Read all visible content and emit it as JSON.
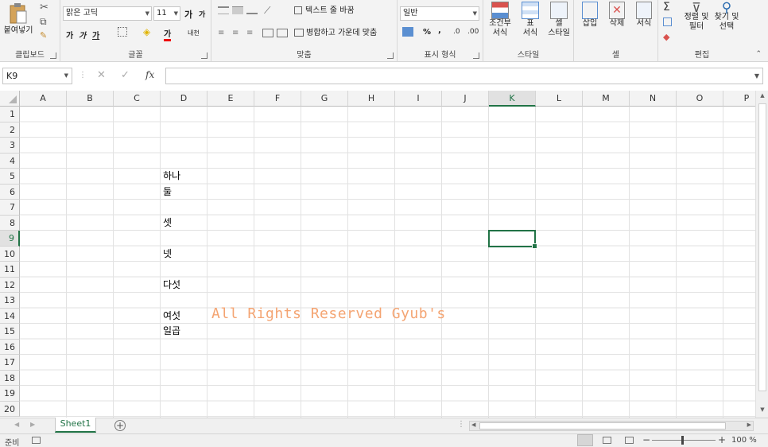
{
  "ribbon": {
    "clipboard": {
      "paste_label": "붙여넣기",
      "group_label": "클립보드"
    },
    "font": {
      "font_name": "맑은 고딕",
      "font_size": "11",
      "grow_label": "가",
      "shrink_label": "가",
      "bold_label": "가",
      "italic_label": "가",
      "underline_label": "가",
      "color_a_label": "가",
      "phonetic_label": "내천",
      "group_label": "글꼴"
    },
    "alignment": {
      "wrap_label": "텍스트 줄 바꿈",
      "merge_label": "병합하고 가운데 맞춤",
      "group_label": "맞춤"
    },
    "number": {
      "format_value": "일반",
      "percent_label": "%",
      "comma_label": ",",
      "group_label": "표시 형식"
    },
    "styles": {
      "conditional_label": "조건부",
      "conditional_sub": "서식",
      "table_label": "표",
      "table_sub": "서식",
      "cell_label": "셀",
      "cell_sub": "스타일",
      "group_label": "스타일"
    },
    "cells": {
      "insert_label": "삽입",
      "delete_label": "삭제",
      "format_label": "서식",
      "group_label": "셀"
    },
    "editing": {
      "sort_label": "정렬 및",
      "sort_sub": "필터",
      "find_label": "찾기 및",
      "find_sub": "선택",
      "group_label": "편집"
    }
  },
  "formula_bar": {
    "name_box": "K9",
    "fx_label": "fx",
    "formula_value": ""
  },
  "grid": {
    "columns": [
      "A",
      "B",
      "C",
      "D",
      "E",
      "F",
      "G",
      "H",
      "I",
      "J",
      "K",
      "L",
      "M",
      "N",
      "O",
      "P"
    ],
    "rows": [
      "1",
      "2",
      "3",
      "4",
      "5",
      "6",
      "7",
      "8",
      "9",
      "10",
      "11",
      "12",
      "13",
      "14",
      "15",
      "16",
      "17",
      "18",
      "19",
      "20"
    ],
    "selected_cell": "K9",
    "cells": {
      "D5": "하나",
      "D6": "둘",
      "D8": "셋",
      "D10": "넷",
      "D12": "다섯",
      "D14": "여섯",
      "D15": "일곱"
    },
    "watermark": "All Rights Reserved Gyub's"
  },
  "sheet_tabs": {
    "tabs": [
      "Sheet1"
    ],
    "active": "Sheet1"
  },
  "status_bar": {
    "ready": "준비",
    "zoom": "100 %"
  },
  "colors": {
    "excel_green": "#217346",
    "watermark": "#f4a472"
  }
}
